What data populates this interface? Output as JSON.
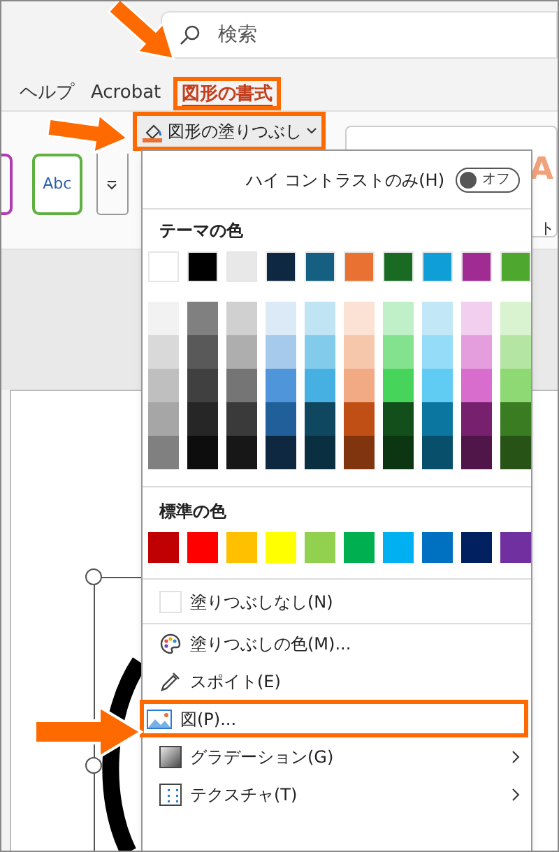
{
  "search": {
    "placeholder": "検索"
  },
  "ribbon_tabs": [
    {
      "label": "ヘルプ",
      "selected": false,
      "annotated": false
    },
    {
      "label": "Acrobat",
      "selected": false,
      "annotated": false
    },
    {
      "label": "図形の書式",
      "selected": true,
      "annotated": true
    }
  ],
  "ribbon": {
    "style_sample": "Abc",
    "fill_button": {
      "label": "図形の塗りつぶし",
      "annotated": true
    },
    "wordart_sample": "A",
    "side_label": "ト"
  },
  "fill_menu": {
    "high_contrast": {
      "label": "ハイ コントラストのみ(H)",
      "toggle": {
        "on": false,
        "label": "オフ"
      }
    },
    "theme_colors": {
      "title": "テーマの色",
      "columns": [
        {
          "color": "#ffffff",
          "shades": [
            {
              "color": "#f2f2f2"
            },
            {
              "color": "#d9d9d9"
            },
            {
              "color": "#bfbfbf"
            },
            {
              "color": "#a6a6a6"
            },
            {
              "color": "#808080"
            }
          ]
        },
        {
          "color": "#000000",
          "shades": [
            {
              "color": "#808080"
            },
            {
              "color": "#595959"
            },
            {
              "color": "#404040"
            },
            {
              "color": "#262626"
            },
            {
              "color": "#0d0d0d"
            }
          ]
        },
        {
          "color": "#e8e8e8",
          "shades": [
            {
              "color": "#d0d0d0"
            },
            {
              "color": "#aeaeae"
            },
            {
              "color": "#757575"
            },
            {
              "color": "#3a3a3a"
            },
            {
              "color": "#171717"
            }
          ]
        },
        {
          "color": "#0e2841",
          "shades": [
            {
              "color": "#dceaf7"
            },
            {
              "color": "#a6caec"
            },
            {
              "color": "#4e95d9"
            },
            {
              "color": "#215f9a"
            },
            {
              "color": "#0e2841"
            }
          ]
        },
        {
          "color": "#156082",
          "shades": [
            {
              "color": "#c1e4f5"
            },
            {
              "color": "#83cbeb"
            },
            {
              "color": "#45b0e1"
            },
            {
              "color": "#0f4761"
            },
            {
              "color": "#0a2f40"
            }
          ]
        },
        {
          "color": "#e97132",
          "shades": [
            {
              "color": "#fbe2d5"
            },
            {
              "color": "#f7c7ac"
            },
            {
              "color": "#f2aa84"
            },
            {
              "color": "#c04f15"
            },
            {
              "color": "#80350e"
            }
          ]
        },
        {
          "color": "#196b24",
          "shades": [
            {
              "color": "#c0f0c8"
            },
            {
              "color": "#83e28e"
            },
            {
              "color": "#47d45a"
            },
            {
              "color": "#124f1a"
            },
            {
              "color": "#0c3511"
            }
          ]
        },
        {
          "color": "#0f9ed5",
          "shades": [
            {
              "color": "#c2e8f7"
            },
            {
              "color": "#95dcf8"
            },
            {
              "color": "#60cbf3"
            },
            {
              "color": "#0b76a0"
            },
            {
              "color": "#074f6a"
            }
          ]
        },
        {
          "color": "#a02b93",
          "shades": [
            {
              "color": "#f2cfee"
            },
            {
              "color": "#e59edd"
            },
            {
              "color": "#d86dcd"
            },
            {
              "color": "#77206d"
            },
            {
              "color": "#501549"
            }
          ]
        },
        {
          "color": "#4ea72e",
          "shades": [
            {
              "color": "#d9f2d0"
            },
            {
              "color": "#b4e5a2"
            },
            {
              "color": "#8ed973"
            },
            {
              "color": "#3a7c22"
            },
            {
              "color": "#275317"
            }
          ]
        }
      ]
    },
    "standard_colors": {
      "title": "標準の色",
      "swatches": [
        {
          "color": "#c00000"
        },
        {
          "color": "#ff0000"
        },
        {
          "color": "#ffc000"
        },
        {
          "color": "#ffff00"
        },
        {
          "color": "#92d050"
        },
        {
          "color": "#00b050"
        },
        {
          "color": "#00b0f0"
        },
        {
          "color": "#0070c0"
        },
        {
          "color": "#002060"
        },
        {
          "color": "#7030a0"
        }
      ]
    },
    "items": [
      {
        "kind": "no-fill",
        "label": "塗りつぶしなし(N)",
        "submenu": false,
        "annotated": false
      },
      {
        "kind": "palette",
        "label": "塗りつぶしの色(M)...",
        "submenu": false,
        "annotated": false
      },
      {
        "kind": "eyedropper",
        "label": "スポイト(E)",
        "submenu": false,
        "annotated": false
      },
      {
        "kind": "picture",
        "label": "図(P)...",
        "submenu": false,
        "annotated": true
      },
      {
        "kind": "gradient",
        "label": "グラデーション(G)",
        "submenu": true,
        "annotated": false
      },
      {
        "kind": "texture",
        "label": "テクスチャ(T)",
        "submenu": true,
        "annotated": false
      }
    ]
  }
}
